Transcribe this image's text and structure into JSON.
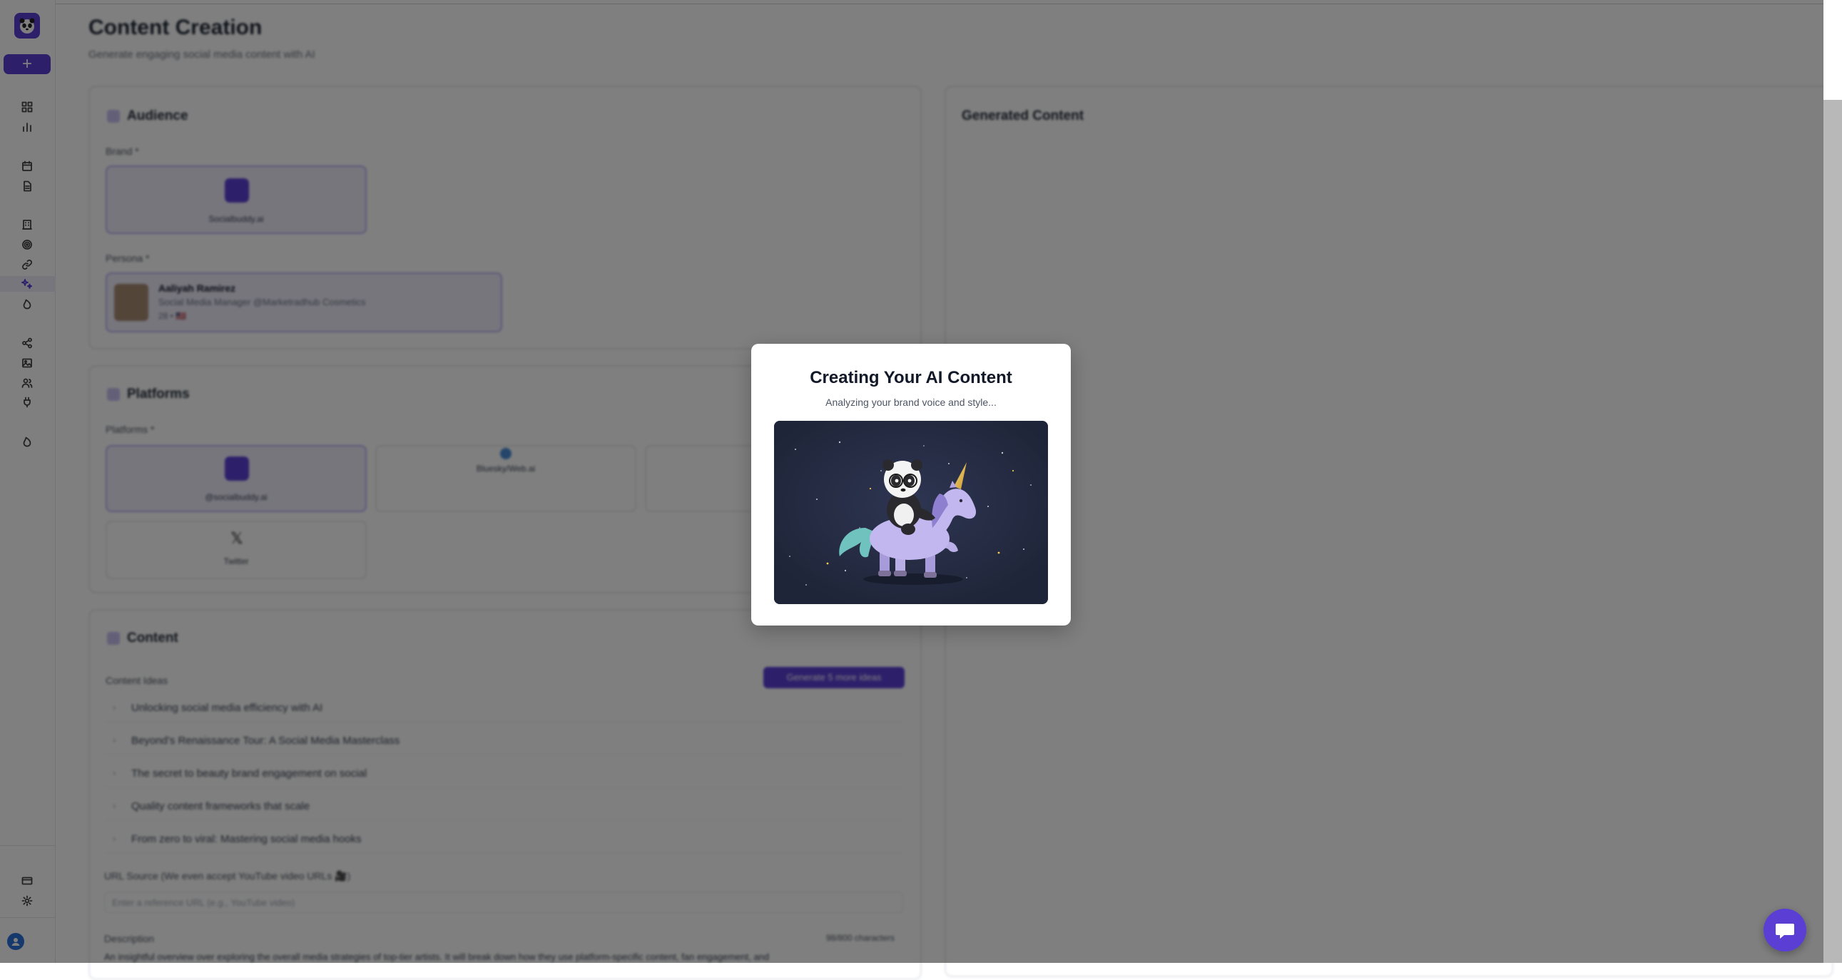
{
  "sidebar": {
    "plus_label": "+",
    "nav_icons": [
      "dashboard-icon",
      "chart-icon",
      "calendar-icon",
      "document-icon",
      "building-icon",
      "target-icon",
      "link-icon",
      "sparkles-icon",
      "flame-icon",
      "share-icon",
      "image-icon",
      "users-icon",
      "plug-icon",
      "fire-icon",
      "card-icon",
      "gear-icon",
      "user-icon"
    ],
    "active_item": "sparkles-icon"
  },
  "page": {
    "title": "Content Creation",
    "subtitle": "Generate engaging social media content with AI"
  },
  "audience": {
    "title": "Audience",
    "brand_label": "Brand *",
    "brand_name": "Socialbuddy.ai",
    "persona_label": "Persona *",
    "persona_name": "Aaliyah Ramirez",
    "persona_role": "Social Media Manager @Marketradhub Cosmetics",
    "persona_meta": "28 • 🇺🇸"
  },
  "platforms": {
    "title": "Platforms",
    "label": "Platforms *",
    "items": [
      "@socialbuddy.ai",
      "Bluesky/Web.ai",
      "Twitter"
    ]
  },
  "content": {
    "title": "Content",
    "ideas_label": "Content Ideas",
    "generate_button": "Generate 5 more ideas",
    "ideas": [
      "Unlocking social media efficiency with AI",
      "Beyond’s Renaissance Tour: A Social Media Masterclass",
      "The secret to beauty brand engagement on social",
      "Quality content frameworks that scale",
      "From zero to viral: Mastering social media hooks"
    ],
    "url_label": "URL Source (We even accept YouTube video URLs 🎥)",
    "url_placeholder": "Enter a reference URL (e.g., YouTube video)",
    "description_label": "Description",
    "char_count": "98/800 characters",
    "description_text": "An insightful overview over exploring the overall media strategies of top-tier artists. It will break down how they use platform-specific content, fan engagement, and"
  },
  "generated": {
    "title": "Generated Content"
  },
  "modal": {
    "title": "Creating Your AI Content",
    "subtitle": "Analyzing your brand voice and style..."
  },
  "colors": {
    "brand": "#5b3fd4",
    "overlay": "rgba(0,0,0,0.5)",
    "image_bg": "#232a40"
  }
}
